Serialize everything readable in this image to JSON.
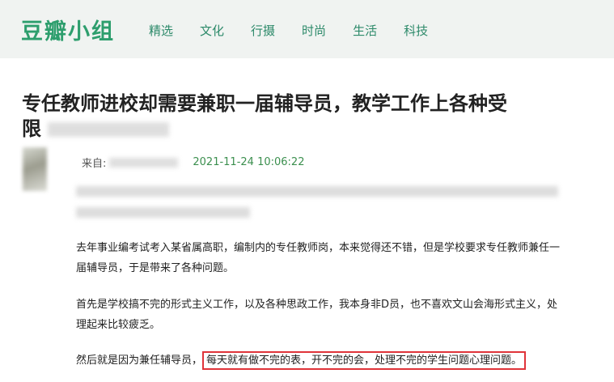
{
  "header": {
    "brand": "豆瓣小组",
    "nav": [
      "精选",
      "文化",
      "行摄",
      "时尚",
      "生活",
      "科技"
    ]
  },
  "post": {
    "title_line1": "专任教师进校却需要兼职一届辅导员，教学工作上各种受",
    "title_line2_start": "限",
    "from_label": "来自:",
    "timestamp": "2021-11-24 10:06:22",
    "paragraph1": "去年事业编考试考入某省属高职，编制内的专任教师岗，本来觉得还不错，但是学校要求专任教师兼任一届辅导员，于是带来了各种问题。",
    "paragraph2": "首先是学校搞不完的形式主义工作，以及各种思政工作，我本身非D员，也不喜欢文山会海形式主义，处理起来比较疲乏。",
    "paragraph3_start": "然后就是因为兼任辅导员，",
    "paragraph3_highlight": "每天就有做不完的表，开不完的会，处理不完的学生问题心理问题。"
  }
}
